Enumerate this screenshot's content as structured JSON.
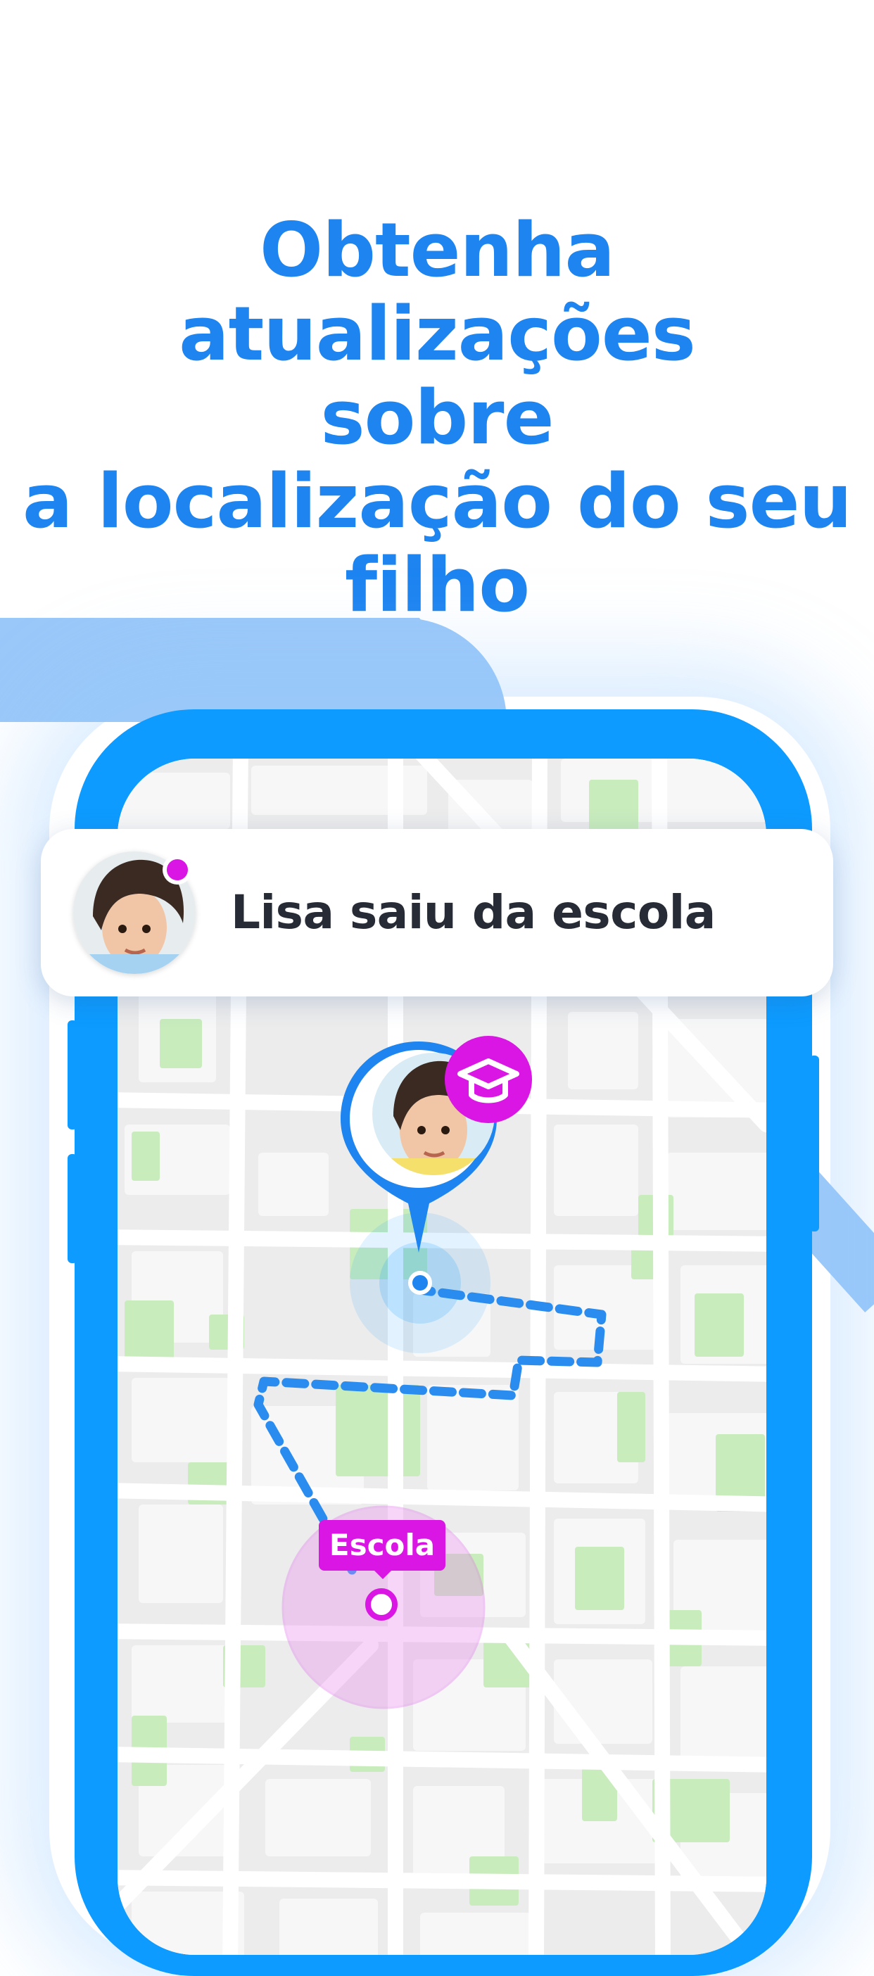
{
  "headline": {
    "lines": [
      "Obtenha atualizações",
      "sobre",
      "a localização do seu",
      "filho"
    ]
  },
  "notification": {
    "text": "Lisa saiu da escola",
    "avatar": "child-photo",
    "status_dot_color": "#d916e3"
  },
  "map": {
    "child_pin": {
      "avatar": "child-photo",
      "badge_icon": "graduation-cap-icon"
    },
    "place_label": "Escola"
  },
  "colors": {
    "brand_blue": "#1d84f0",
    "phone_frame": "#0d9bff",
    "accent_magenta": "#d916e3",
    "decor_light_blue": "#9ac8f9",
    "map_park_green": "#c9ecbd"
  }
}
